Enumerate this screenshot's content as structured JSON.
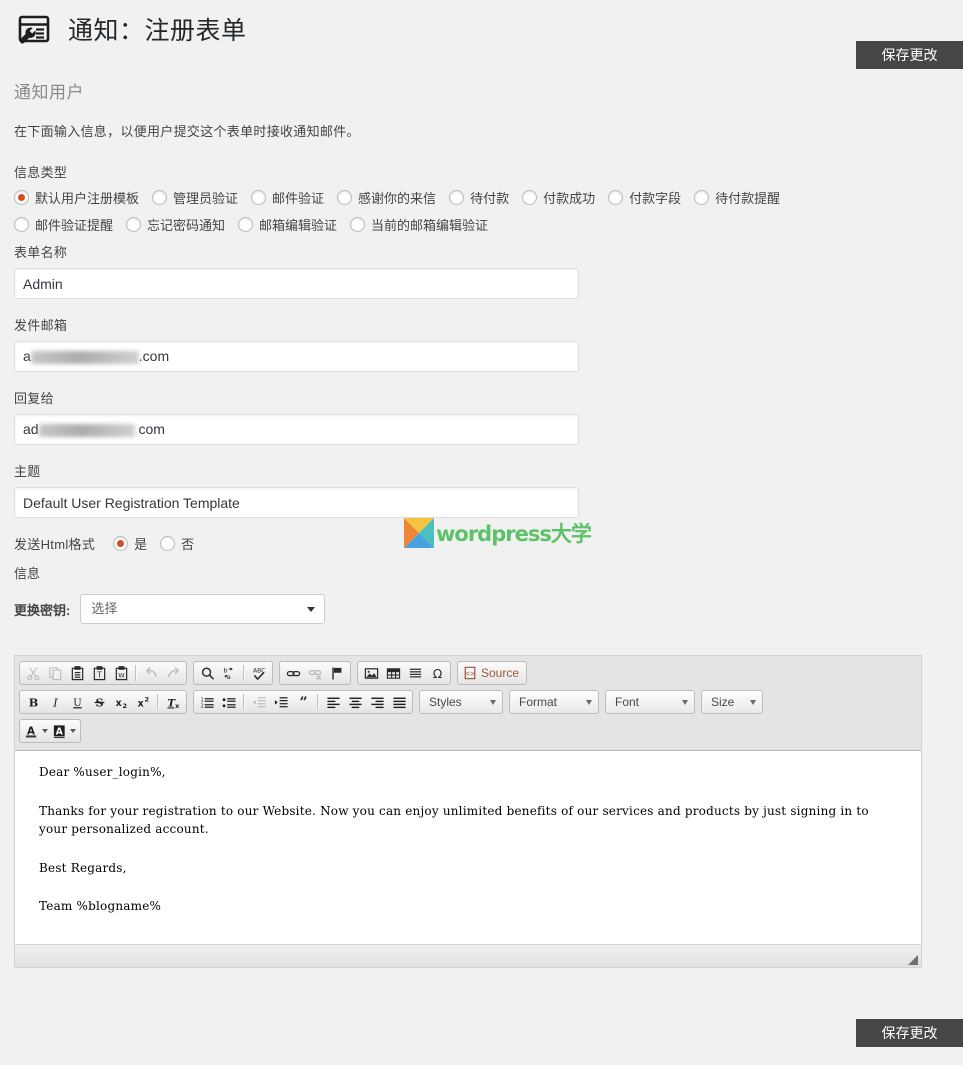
{
  "header": {
    "icon": "form-wrench-icon",
    "title": "通知：注册表单",
    "save_label": "保存更改"
  },
  "intro": {
    "heading": "通知用户",
    "description": "在下面输入信息，以便用户提交这个表单时接收通知邮件。"
  },
  "message_type": {
    "label": "信息类型",
    "options": [
      {
        "label": "默认用户注册模板",
        "checked": true
      },
      {
        "label": "管理员验证",
        "checked": false
      },
      {
        "label": "邮件验证",
        "checked": false
      },
      {
        "label": "感谢你的来信",
        "checked": false
      },
      {
        "label": "待付款",
        "checked": false
      },
      {
        "label": "付款成功",
        "checked": false
      },
      {
        "label": "付款字段",
        "checked": false
      },
      {
        "label": "待付款提醒",
        "checked": false
      },
      {
        "label": "邮件验证提醒",
        "checked": false
      },
      {
        "label": "忘记密码通知",
        "checked": false
      },
      {
        "label": "邮箱编辑验证",
        "checked": false
      },
      {
        "label": "当前的邮箱编辑验证",
        "checked": false
      }
    ]
  },
  "fields": {
    "form_name": {
      "label": "表单名称",
      "value": "Admin",
      "placeholder": ""
    },
    "from_email": {
      "label": "发件邮箱",
      "prefix": "a",
      "suffix": ".com",
      "redacted": true
    },
    "reply_to": {
      "label": "回复给",
      "prefix": "ad",
      "suffix": " com",
      "redacted": true
    },
    "subject": {
      "label": "主题",
      "value": "Default User Registration Template",
      "placeholder": ""
    }
  },
  "html_format": {
    "label": "发送Html格式",
    "options": [
      {
        "label": "是",
        "checked": true
      },
      {
        "label": "否",
        "checked": false
      }
    ]
  },
  "message_section": {
    "label": "信息",
    "key_label": "更换密钥:",
    "key_selected": "选择"
  },
  "watermark": {
    "text": "wordpress大学",
    "colors": {
      "orange": "#ef8633",
      "yellow": "#f5c542",
      "teal": "#4bc0c0",
      "blue": "#4aa3e0",
      "green": "#5ec269"
    }
  },
  "editor": {
    "toolbar_row1": [
      {
        "name": "cut-icon",
        "title": "剪切",
        "disabled": true
      },
      {
        "name": "copy-icon",
        "title": "复制",
        "disabled": true
      },
      {
        "name": "paste-icon",
        "title": "粘贴",
        "disabled": false
      },
      {
        "name": "paste-text-icon",
        "title": "粘贴为无格式文本",
        "disabled": false
      },
      {
        "name": "paste-word-icon",
        "title": "从 Word 粘贴",
        "disabled": false
      },
      {
        "name": "separator"
      },
      {
        "name": "undo-icon",
        "title": "撤销",
        "disabled": true
      },
      {
        "name": "redo-icon",
        "title": "重做",
        "disabled": true
      }
    ],
    "toolbar_row1_group2": [
      {
        "name": "search-icon",
        "title": "查找",
        "disabled": false
      },
      {
        "name": "replace-icon",
        "title": "替换",
        "disabled": false
      },
      {
        "name": "separator"
      },
      {
        "name": "spellcheck-icon",
        "title": "拼写检查",
        "disabled": false
      }
    ],
    "toolbar_row1_group3": [
      {
        "name": "link-icon",
        "title": "链接",
        "disabled": false
      },
      {
        "name": "unlink-icon",
        "title": "去除链接",
        "disabled": true
      },
      {
        "name": "anchor-flag-icon",
        "title": "锚点",
        "disabled": false
      }
    ],
    "toolbar_row1_group4": [
      {
        "name": "image-icon",
        "title": "图像",
        "disabled": false
      },
      {
        "name": "table-icon",
        "title": "表格",
        "disabled": false
      },
      {
        "name": "horizontal-rule-icon",
        "title": "水平线",
        "disabled": false
      },
      {
        "name": "special-char-icon",
        "title": "特殊字符",
        "disabled": false
      }
    ],
    "source_button": {
      "name": "source-button",
      "label": "Source"
    },
    "toolbar_row2_group1": [
      {
        "name": "bold-icon",
        "title": "加粗",
        "glyph": "B"
      },
      {
        "name": "italic-icon",
        "title": "倾斜",
        "glyph": "I"
      },
      {
        "name": "underline-icon",
        "title": "下划线",
        "glyph": "U"
      },
      {
        "name": "strike-icon",
        "title": "删除线",
        "glyph": "S"
      },
      {
        "name": "subscript-icon",
        "title": "下标",
        "glyph": "x₂"
      },
      {
        "name": "superscript-icon",
        "title": "上标",
        "glyph": "x²"
      },
      {
        "name": "separator"
      },
      {
        "name": "remove-format-icon",
        "title": "清除格式",
        "glyph": "Tx"
      }
    ],
    "toolbar_row2_group2": [
      {
        "name": "numbered-list-icon",
        "title": "编号列表",
        "disabled": false
      },
      {
        "name": "bulleted-list-icon",
        "title": "项目列表",
        "disabled": false
      },
      {
        "name": "separator"
      },
      {
        "name": "outdent-icon",
        "title": "减少缩进",
        "disabled": true
      },
      {
        "name": "indent-icon",
        "title": "增加缩进",
        "disabled": false
      },
      {
        "name": "blockquote-icon",
        "title": "块引用",
        "disabled": false
      },
      {
        "name": "separator"
      },
      {
        "name": "align-left-icon",
        "title": "左对齐",
        "disabled": false
      },
      {
        "name": "align-center-icon",
        "title": "居中",
        "disabled": false
      },
      {
        "name": "align-right-icon",
        "title": "右对齐",
        "disabled": false
      },
      {
        "name": "align-justify-icon",
        "title": "两端对齐",
        "disabled": false
      }
    ],
    "combos": [
      {
        "name": "styles-combo",
        "label": "Styles"
      },
      {
        "name": "format-combo",
        "label": "Format"
      },
      {
        "name": "font-combo",
        "label": "Font"
      },
      {
        "name": "size-combo",
        "label": "Size"
      }
    ],
    "color_buttons": [
      {
        "name": "text-color-icon",
        "title": "文本颜色",
        "glyph": "A"
      },
      {
        "name": "background-color-icon",
        "title": "背景颜色",
        "glyph": "A"
      }
    ],
    "content": [
      "Dear %user_login%,",
      "Thanks for your registration to our Website. Now you can enjoy unlimited benefits of our services and products by just signing in to your personalized account.",
      "Best Regards,",
      "Team %blogname%"
    ]
  },
  "footer": {
    "save_label": "保存更改"
  }
}
